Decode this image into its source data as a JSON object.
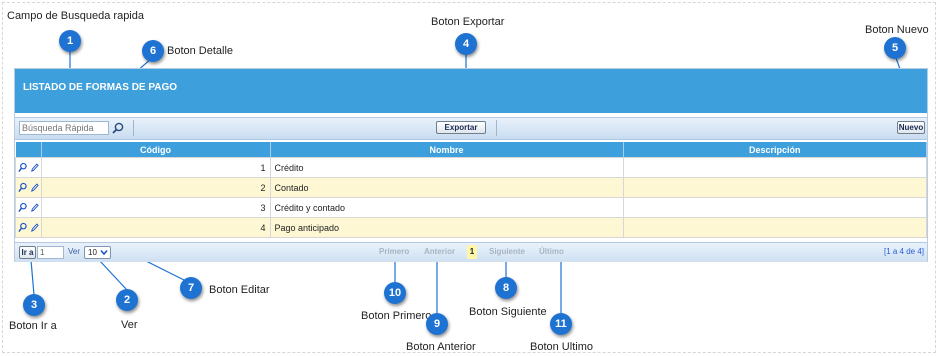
{
  "annotations": {
    "campo_busqueda": "Campo de Busqueda rapida",
    "boton_detalle": "Boton Detalle",
    "boton_exportar": "Boton Exportar",
    "boton_nuevo": "Boton Nuevo",
    "boton_ir_a": "Boton Ir a",
    "ver": "Ver",
    "boton_editar": "Boton Editar",
    "boton_primero": "Boton Primero",
    "boton_anterior": "Boton Anterior",
    "boton_siguiente": "Boton Siguiente",
    "boton_ultimo": "Boton Ultimo"
  },
  "badges": {
    "b1": "1",
    "b2": "2",
    "b3": "3",
    "b4": "4",
    "b5": "5",
    "b6": "6",
    "b7": "7",
    "b8": "8",
    "b9": "9",
    "b10": "10",
    "b11": "11"
  },
  "panel": {
    "title": "LISTADO DE FORMAS DE PAGO",
    "search_placeholder": "Búsqueda Rápida",
    "export_label": "Exportar",
    "new_label": "Nuevo"
  },
  "table": {
    "headers": {
      "codigo": "Código",
      "nombre": "Nombre",
      "descripcion": "Descripción"
    },
    "rows": [
      {
        "codigo": "1",
        "nombre": "Crédito",
        "descripcion": ""
      },
      {
        "codigo": "2",
        "nombre": "Contado",
        "descripcion": ""
      },
      {
        "codigo": "3",
        "nombre": "Crédito y contado",
        "descripcion": ""
      },
      {
        "codigo": "4",
        "nombre": "Pago anticipado",
        "descripcion": ""
      }
    ]
  },
  "pager": {
    "ir_a_label": "Ir a",
    "page_value": "1",
    "ver_label": "Ver",
    "per_page": "10",
    "first": "Primero",
    "prev": "Anterior",
    "current": "1",
    "next": "Siguiente",
    "last": "Último",
    "range": "[1 a 4 de 4]"
  },
  "colors": {
    "accent": "#3d9fdc",
    "badge": "#1e73d2",
    "row_alt": "#fdf7d3"
  },
  "icons": [
    "magnifier-icon",
    "pencil-icon",
    "chevron-down-icon"
  ]
}
